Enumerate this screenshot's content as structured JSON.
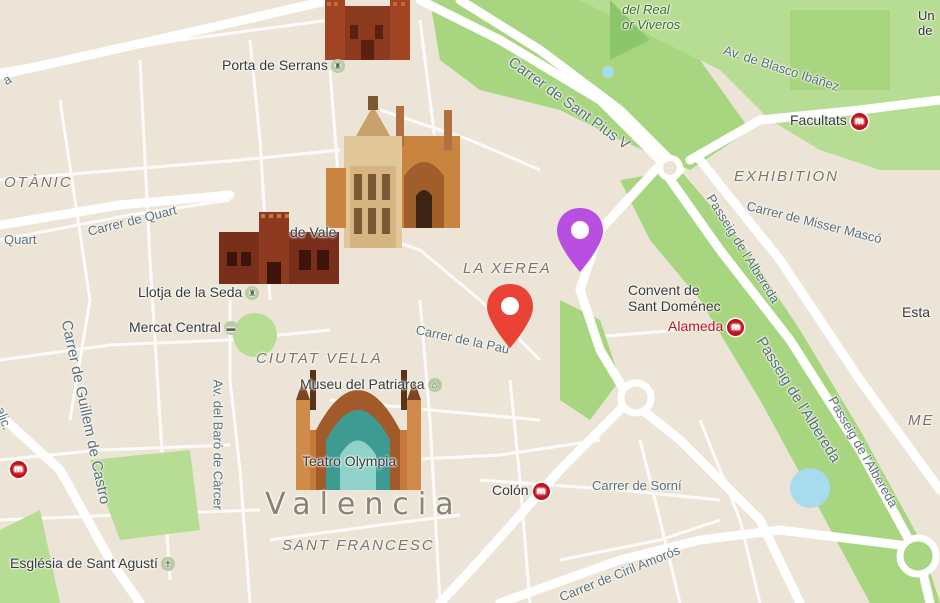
{
  "map": {
    "city_label": "Valencia",
    "districts": {
      "ciutat_vella": "CIUTAT VELLA",
      "la_xerea": "LA XEREA",
      "sant_francesc": "SANT FRANCESC",
      "exhibition": "EXHIBITION",
      "botanic": "OTÀNIC",
      "me_edge": "ME"
    },
    "streets": {
      "carrer_de_quart": "Carrer de Quart",
      "quart_edge": "Quart",
      "carrer_de_la_pau": "Carrer de la Pau",
      "carrer_sant_pius": "Carrer de Sant Pius V",
      "blasco_ibanez": "Av. de Blasco Ibáñez",
      "misser_masco": "Carrer de Misser Mascó",
      "passeig_alberda_1": "Passeig de l'Albereda",
      "passeig_alberda_2": "Passeig de l'Albereda",
      "passeig_alberda_3": "Passeig de l'Albereda",
      "carrer_guillem_castro": "Carrer de Guillem de Castro",
      "av_baro_carcer": "Av. del Baró de Càrcer",
      "carrer_de_sorni": "Carrer de Sorní",
      "ciril_amoros": "Carrer de Ciril Amorós",
      "alic_edge": "alic.",
      "la_edge": "a"
    },
    "pois": {
      "porta_serrans": "Porta de Serrans",
      "llotja": "Llotja de la Seda",
      "mercat": "Mercat Central",
      "museu_patriarca": "Museu del Patriarca",
      "convent": "Convent de\nSant Doménec",
      "esglesia": "Església de Sant Agustí",
      "teatre": "Teatro Olympia",
      "placa_vale": "de Vale"
    },
    "park_labels": {
      "viveros": "del Real\nor Viveros",
      "top_right": "Un\nde"
    },
    "metro_stations": {
      "facultats": "Facultats",
      "alameda": "Alameda",
      "colon": "Colón",
      "estac_edge": "Esta",
      "metro_symbol": "m"
    },
    "markers": [
      {
        "name": "purple-marker",
        "color": "#b94fe0"
      },
      {
        "name": "red-marker",
        "color": "#ea4335"
      }
    ],
    "colors": {
      "land": "#ede6d8",
      "park": "#a8d57f",
      "park_light": "#c4e3a3",
      "road": "#ffffff",
      "metro": "#c0101a"
    }
  }
}
